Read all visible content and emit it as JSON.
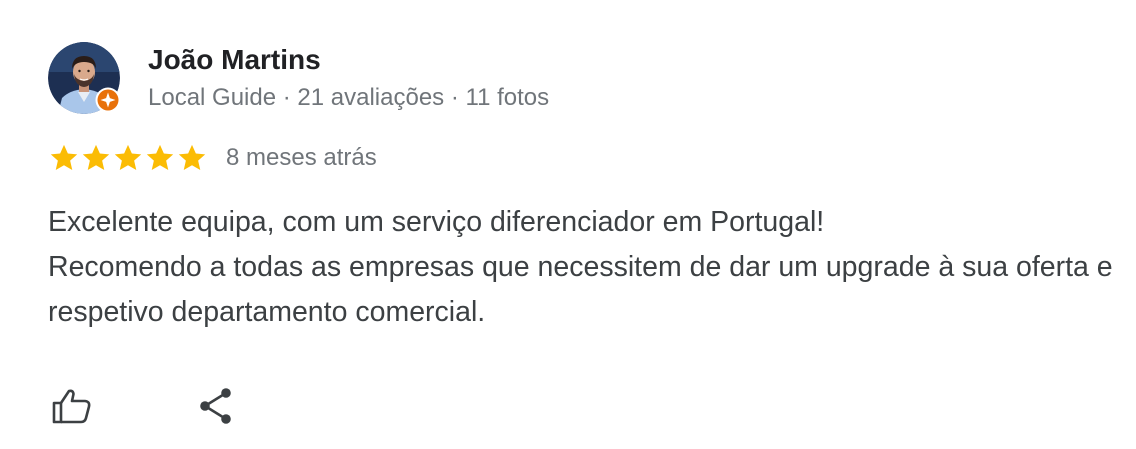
{
  "reviewer": {
    "name": "João Martins",
    "meta": "Local Guide · 21 avaliações · 11 fotos",
    "avatar_icon": "profile-photo",
    "badge_icon": "local-guide-badge-icon"
  },
  "review": {
    "rating": 5,
    "rating_max": 5,
    "date": "8 meses atrás",
    "lines": [
      "Excelente equipa, com um serviço diferenciador em Portugal!",
      "Recomendo a todas as empresas que necessitem de dar um upgrade à sua oferta e respetivo departamento comercial."
    ]
  },
  "actions": {
    "like_icon": "thumbs-up-icon",
    "share_icon": "share-icon"
  },
  "colors": {
    "star": "#fbbc04",
    "badge": "#e8710a",
    "name": "#202124",
    "meta": "#70757a",
    "text": "#3c4043",
    "icon": "#3c4043"
  }
}
